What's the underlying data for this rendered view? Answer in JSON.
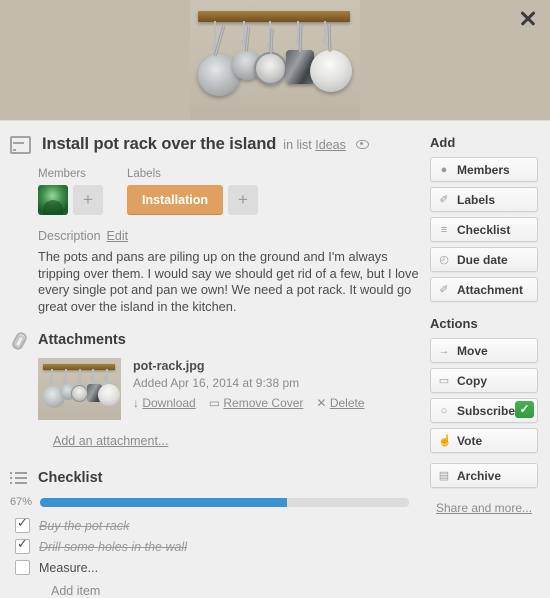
{
  "close_label": "×",
  "card": {
    "title": "Install pot rack over the island",
    "in_list_prefix": "in list",
    "list_name": "Ideas"
  },
  "members": {
    "heading": "Members",
    "add_label": "+"
  },
  "labels": {
    "heading": "Labels",
    "chip": "Installation",
    "chip_color": "#e0a060",
    "add_label": "+"
  },
  "description": {
    "heading": "Description",
    "edit_label": "Edit",
    "text": "The pots and pans are piling up on the ground and I'm always tripping over them. I would say we should get rid of a few, but I love every single pot and pan we own! We need a pot rack. It would go great over the island in the kitchen."
  },
  "attachments": {
    "heading": "Attachments",
    "file_name": "pot-rack.jpg",
    "added_text": "Added Apr 16, 2014 at 9:38 pm",
    "download_label": "Download",
    "remove_cover_label": "Remove Cover",
    "delete_label": "Delete",
    "add_label": "Add an attachment..."
  },
  "checklist": {
    "heading": "Checklist",
    "percent_label": "67%",
    "percent_value": 67,
    "fill_color": "#3a93d0",
    "items": [
      {
        "text": "Buy the pot rack",
        "checked": true
      },
      {
        "text": "Drill some holes in the wall",
        "checked": true
      },
      {
        "text": "Measure...",
        "checked": false
      }
    ],
    "add_item_label": "Add item"
  },
  "sidebar": {
    "add_heading": "Add",
    "add_items": [
      {
        "label": "Members",
        "icon": "person-icon",
        "glyph": "●"
      },
      {
        "label": "Labels",
        "icon": "tag-icon",
        "glyph": "✐"
      },
      {
        "label": "Checklist",
        "icon": "checklist-icon",
        "glyph": "≡"
      },
      {
        "label": "Due date",
        "icon": "clock-icon",
        "glyph": "◴"
      },
      {
        "label": "Attachment",
        "icon": "paperclip-icon",
        "glyph": "✐"
      }
    ],
    "actions_heading": "Actions",
    "action_items": [
      {
        "label": "Move",
        "icon": "arrow-right-icon",
        "glyph": "→"
      },
      {
        "label": "Copy",
        "icon": "copy-icon",
        "glyph": "▭"
      },
      {
        "label": "Subscribe",
        "icon": "eye-icon",
        "glyph": "○",
        "badge": "✓"
      },
      {
        "label": "Vote",
        "icon": "thumbs-up-icon",
        "glyph": "☝"
      },
      {
        "label": "Archive",
        "icon": "archive-box-icon",
        "glyph": "▤"
      }
    ],
    "share_label": "Share and more..."
  }
}
